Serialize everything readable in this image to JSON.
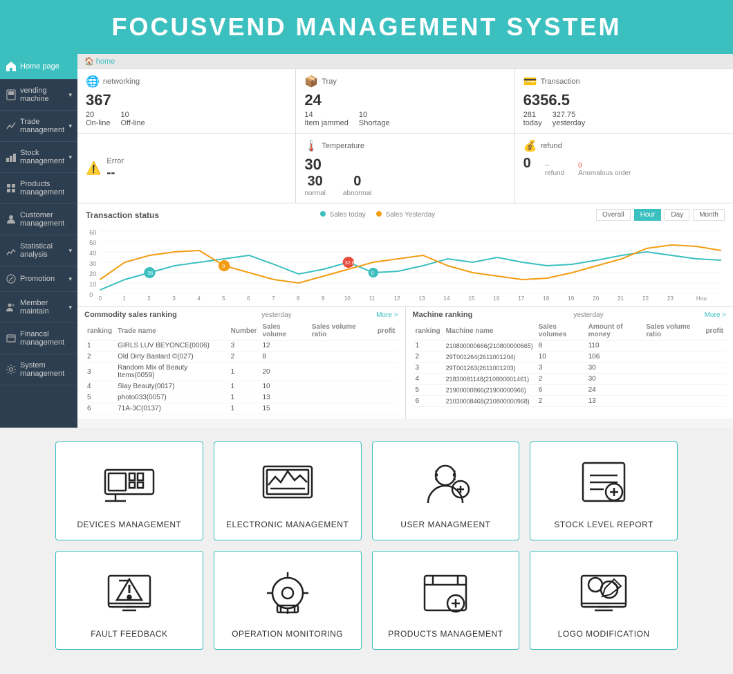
{
  "header": {
    "title": "FOCUSVEND MANAGEMENT SYSTEM"
  },
  "sidebar": {
    "items": [
      {
        "label": "Home page",
        "active": true,
        "icon": "home"
      },
      {
        "label": "vending machine",
        "icon": "machine",
        "hasArrow": true
      },
      {
        "label": "Trade management",
        "icon": "trade",
        "hasArrow": true
      },
      {
        "label": "Stock management",
        "icon": "stock",
        "hasArrow": true
      },
      {
        "label": "Products management",
        "icon": "products"
      },
      {
        "label": "Customer management",
        "icon": "customer"
      },
      {
        "label": "Statistical analysis",
        "icon": "stats",
        "hasArrow": true
      },
      {
        "label": "Promotion",
        "icon": "promo",
        "hasArrow": true
      },
      {
        "label": "Member maintain",
        "icon": "member",
        "hasArrow": true
      },
      {
        "label": "Financal management",
        "icon": "finance"
      },
      {
        "label": "System management",
        "icon": "system"
      }
    ]
  },
  "breadcrumb": "home",
  "stats": {
    "networking": {
      "title": "networking",
      "big": "367",
      "sub1_label": "On-line",
      "sub1_val": "20",
      "sub2_label": "Off-line",
      "sub2_val": "10"
    },
    "tray": {
      "title": "Tray",
      "big": "24",
      "sub1_label": "Item jammed",
      "sub1_val": "14",
      "sub2_label": "Shortage",
      "sub2_val": "10"
    },
    "transaction": {
      "title": "Transaction",
      "big": "6356.5",
      "sub1_label": "today",
      "sub1_val": "281",
      "sub2_label": "yesterday",
      "sub2_val": "327.75"
    },
    "error": {
      "title": "Error",
      "val": "--"
    },
    "temperature": {
      "title": "Temperature",
      "big": "30",
      "normal_label": "normal",
      "normal_val": "30",
      "abnormal_label": "abnormal",
      "abnormal_val": "0"
    },
    "refund": {
      "title": "refund",
      "val": "0",
      "refund_label": "refund",
      "refund_val": "--",
      "anomalous_label": "Anomalous order",
      "anomalous_val": "0"
    }
  },
  "chart": {
    "title": "Transaction status",
    "legend": [
      {
        "label": "Sales today",
        "color": "#3bbfbf"
      },
      {
        "label": "Sales Yesterday",
        "color": "#f39c12"
      }
    ],
    "tabs": [
      "Overall",
      "Hour",
      "Day",
      "Month"
    ],
    "active_tab": "Hour"
  },
  "commodity_table": {
    "title": "Commodity sales ranking",
    "yesterday_label": "yesterday",
    "more_label": "More >",
    "headers": [
      "ranking",
      "Trade name",
      "Number",
      "Sales volume",
      "Sales volume ratio",
      "profit"
    ],
    "rows": [
      {
        "rank": "1",
        "name": "GIRLS LUV BEYONCE(0006)",
        "number": "3",
        "sales": "12",
        "ratio": "",
        "profit": ""
      },
      {
        "rank": "2",
        "name": "Old Dirty Bastard ©(027)",
        "number": "2",
        "sales": "8",
        "ratio": "",
        "profit": ""
      },
      {
        "rank": "3",
        "name": "Random Mix of Beauty Items(0059)",
        "number": "1",
        "sales": "20",
        "ratio": "",
        "profit": ""
      },
      {
        "rank": "4",
        "name": "Slay Beauty(0017)",
        "number": "1",
        "sales": "10",
        "ratio": "",
        "profit": ""
      },
      {
        "rank": "5",
        "name": "photo033(0057)",
        "number": "1",
        "sales": "13",
        "ratio": "",
        "profit": ""
      },
      {
        "rank": "6",
        "name": "71A-3C(0137)",
        "number": "1",
        "sales": "15",
        "ratio": "",
        "profit": ""
      }
    ]
  },
  "machine_table": {
    "title": "Machine ranking",
    "yesterday_label": "yesterday",
    "more_label": "More >",
    "headers": [
      "ranking",
      "Machine name",
      "Sales volumes",
      "Amount of money",
      "Sales volume ratio",
      "profit"
    ],
    "rows": [
      {
        "rank": "1",
        "name": "210800000666(210800000665)",
        "sales": "8",
        "amount": "110",
        "ratio": "",
        "profit": ""
      },
      {
        "rank": "2",
        "name": "29T001264(2611001204)",
        "sales": "10",
        "amount": "106",
        "ratio": "",
        "profit": ""
      },
      {
        "rank": "3",
        "name": "29T001263(2611001203)",
        "sales": "3",
        "amount": "30",
        "ratio": "",
        "profit": ""
      },
      {
        "rank": "4",
        "name": "21830081148(210800001461)",
        "sales": "2",
        "amount": "30",
        "ratio": "",
        "profit": ""
      },
      {
        "rank": "5",
        "name": "21900000866(21900000966)",
        "sales": "6",
        "amount": "24",
        "ratio": "",
        "profit": ""
      },
      {
        "rank": "6",
        "name": "21030008468(210800000968)",
        "sales": "2",
        "amount": "13",
        "ratio": "",
        "profit": ""
      }
    ]
  },
  "shortcuts": {
    "row1": [
      {
        "label": "DEVICES MANAGEMENT",
        "icon": "devices"
      },
      {
        "label": "ELECTRONIC MANAGEMENT",
        "icon": "electronic"
      },
      {
        "label": "USER MANAGMEENT",
        "icon": "user"
      },
      {
        "label": "STOCK LEVEL REPORT",
        "icon": "stock"
      }
    ],
    "row2": [
      {
        "label": "FAULT FEEDBACK",
        "icon": "fault"
      },
      {
        "label": "OPERATION MONITORING",
        "icon": "operation"
      },
      {
        "label": "PRODUCTS MANAGEMENT",
        "icon": "products"
      },
      {
        "label": "LOGO MODIFICATION",
        "icon": "logo"
      }
    ]
  }
}
